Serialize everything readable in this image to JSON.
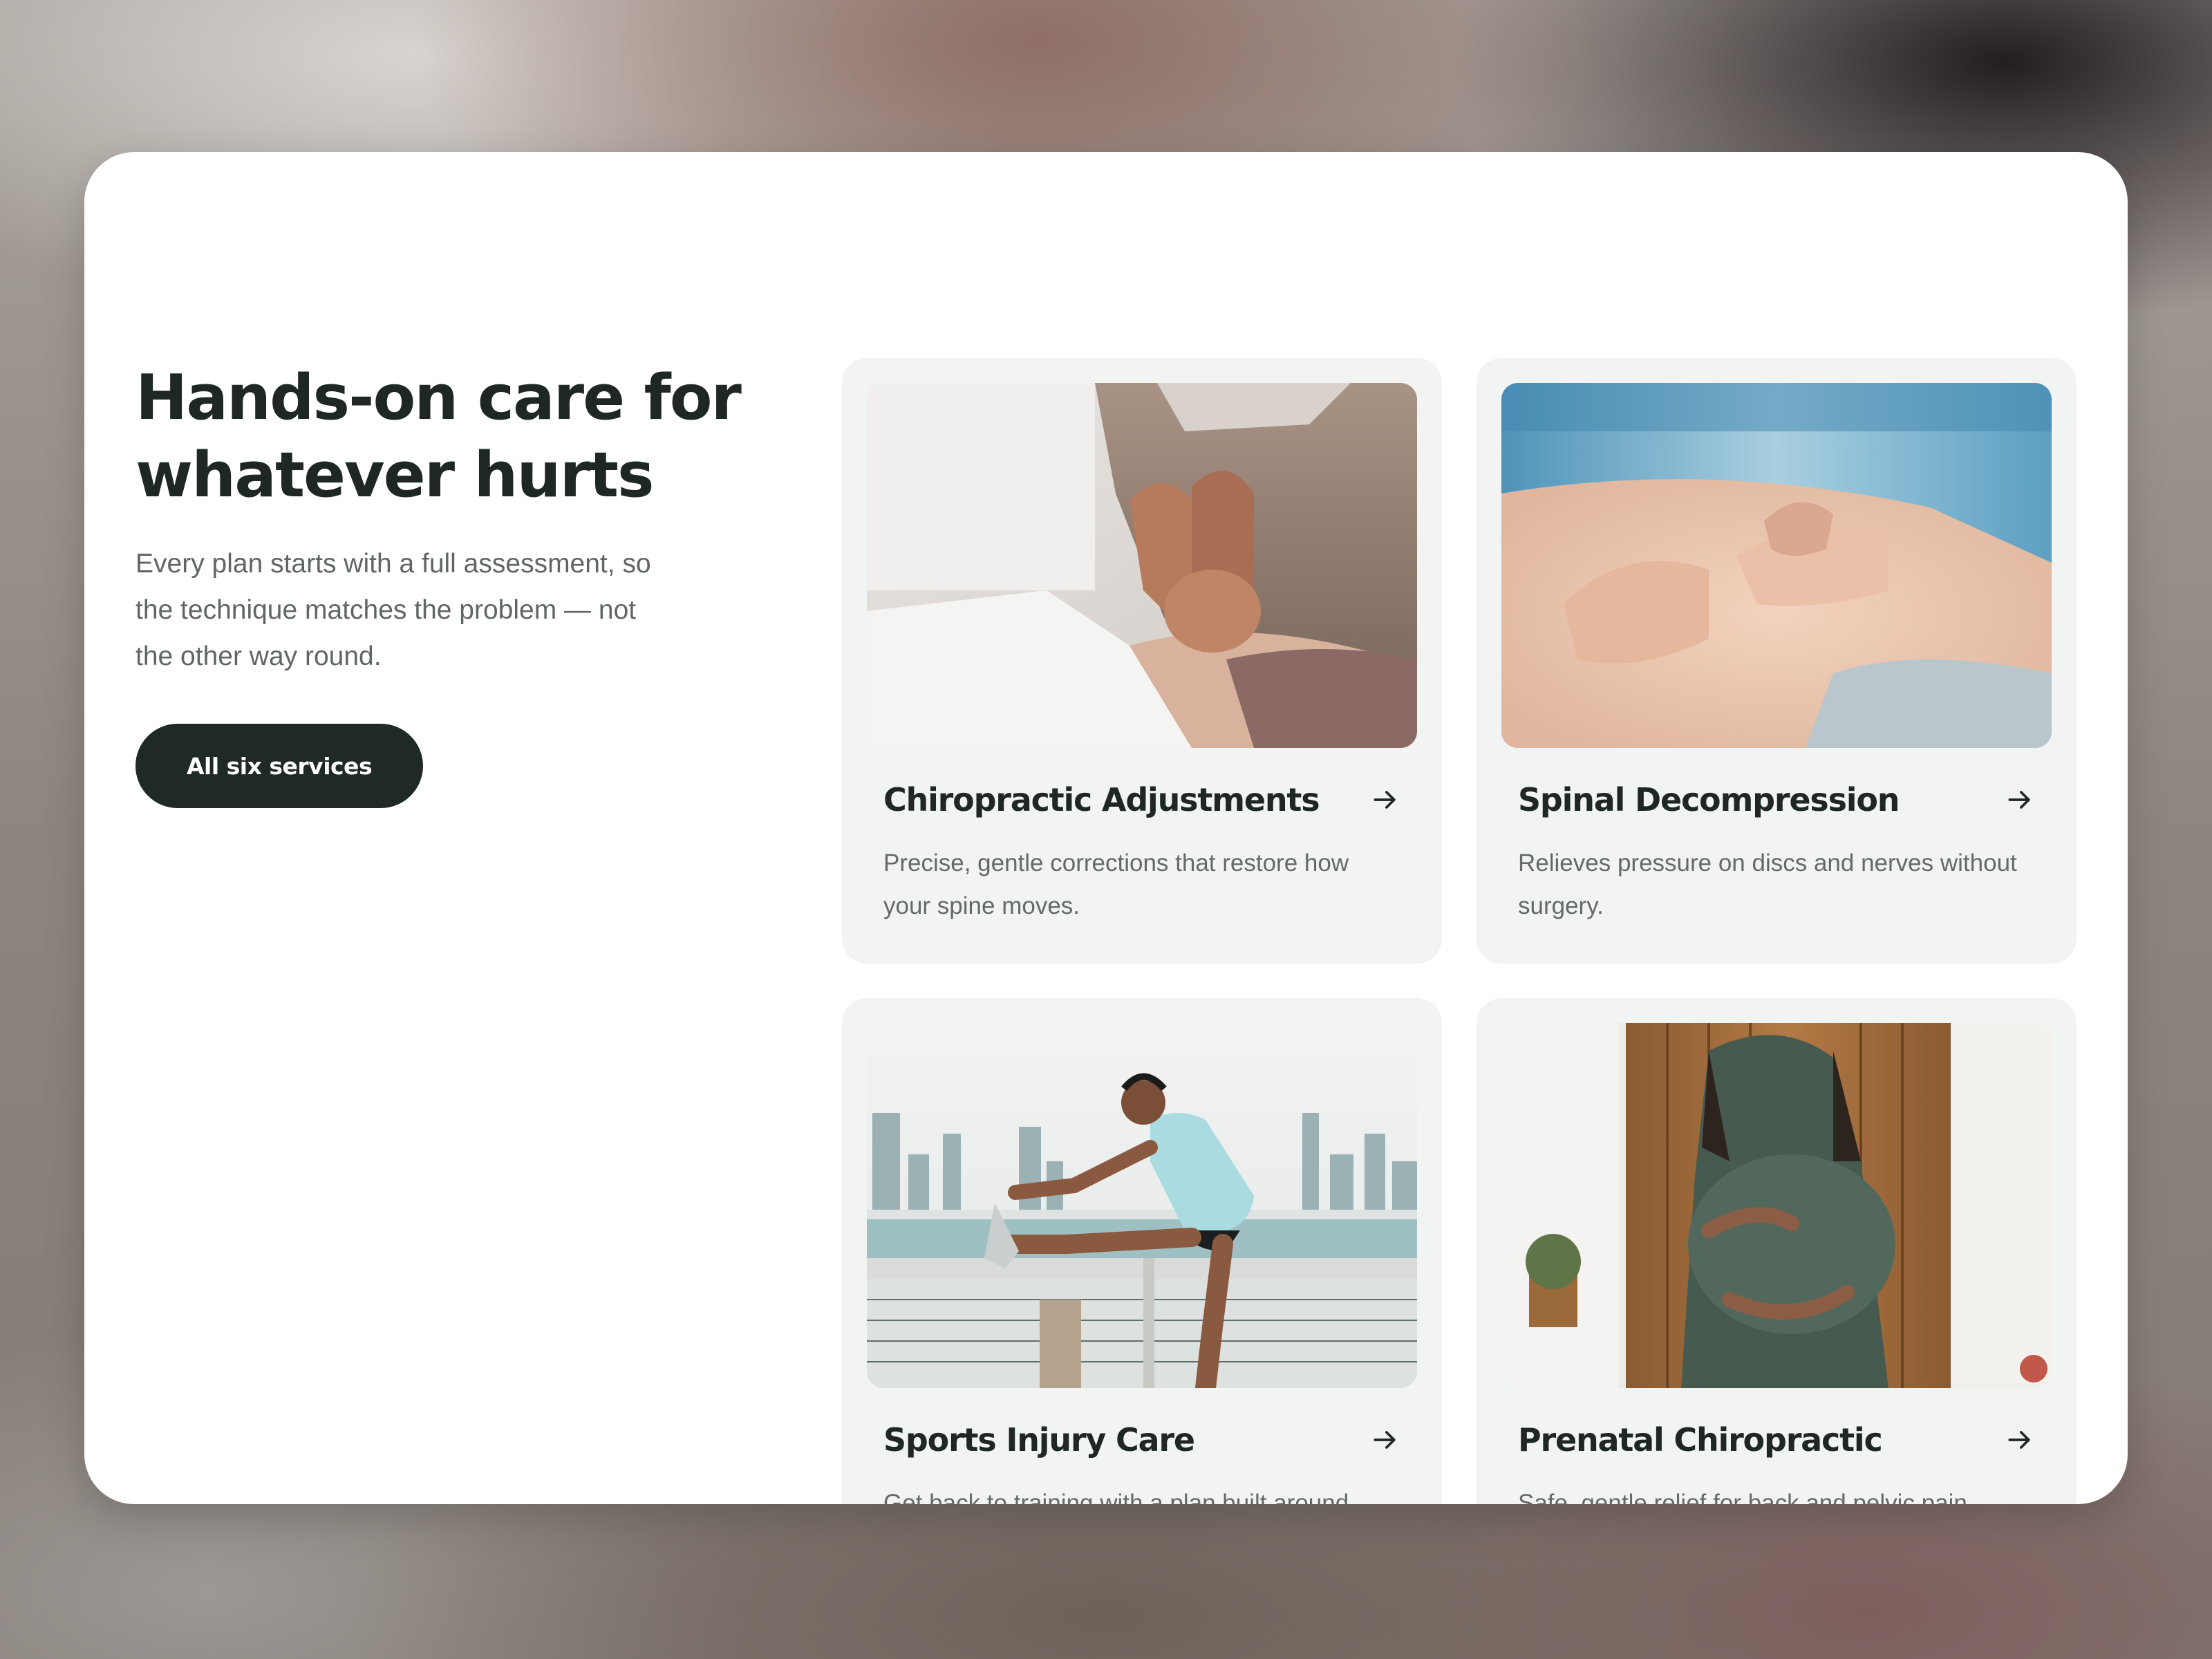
{
  "intro": {
    "headline": "Hands-on care for whatever hurts",
    "lead": "Every plan starts with a full assessment, so the technique matches the problem — not the other way round.",
    "cta_label": "All six services"
  },
  "services": [
    {
      "title": "Chiropractic Adjustments",
      "description": "Precise, gentle corrections that restore how your spine moves.",
      "icon": "arrow-right-icon"
    },
    {
      "title": "Spinal Decompression",
      "description": "Relieves pressure on discs and nerves without surgery.",
      "icon": "arrow-right-icon"
    },
    {
      "title": "Sports Injury Care",
      "description": "Get back to training with a plan built around",
      "icon": "arrow-right-icon"
    },
    {
      "title": "Prenatal Chiropractic",
      "description": "Safe, gentle relief for back and pelvic pain",
      "icon": "arrow-right-icon"
    }
  ],
  "colors": {
    "text_dark": "#1e2724",
    "text_muted": "#5f6663",
    "card_bg": "#f2f4f3",
    "button_bg": "#1f2a26"
  }
}
